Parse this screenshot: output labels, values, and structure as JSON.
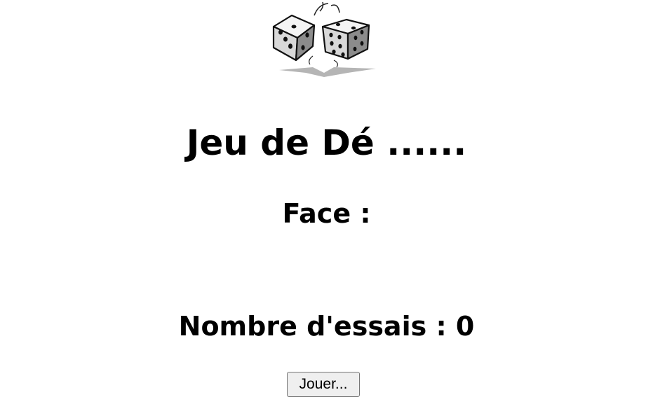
{
  "header": {
    "logo_icon": "dice-icon"
  },
  "main": {
    "title": "Jeu de Dé ......",
    "face_label": "Face :",
    "face_value": "",
    "tries_label": "Nombre d'essais :",
    "tries_value": "0"
  },
  "actions": {
    "play_label": "Jouer..."
  }
}
